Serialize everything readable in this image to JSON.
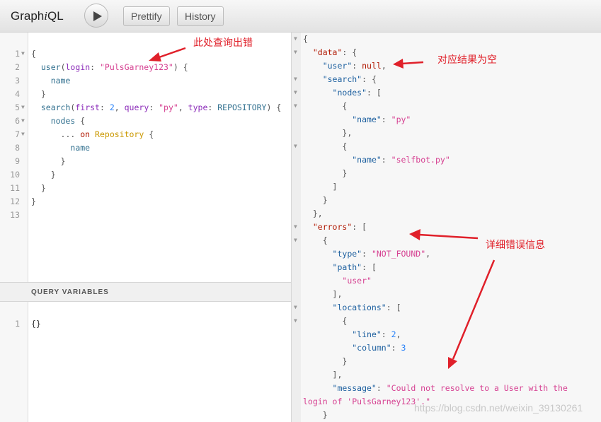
{
  "toolbar": {
    "logo_pre": "Graph",
    "logo_i": "i",
    "logo_post": "QL",
    "prettify": "Prettify",
    "history": "History",
    "run_icon": "play-icon"
  },
  "query_lines": [
    "1",
    "2",
    "3",
    "4",
    "5",
    "6",
    "7",
    "8",
    "9",
    "10",
    "11",
    "12",
    "13"
  ],
  "vars": {
    "title": "QUERY VARIABLES",
    "line": "1",
    "value": "{}"
  },
  "annotations": {
    "query_error": "此处查询出错",
    "null_result": "对应结果为空",
    "error_detail": "详细错误信息"
  },
  "watermark": "https://blog.csdn.net/weixin_39130261"
}
